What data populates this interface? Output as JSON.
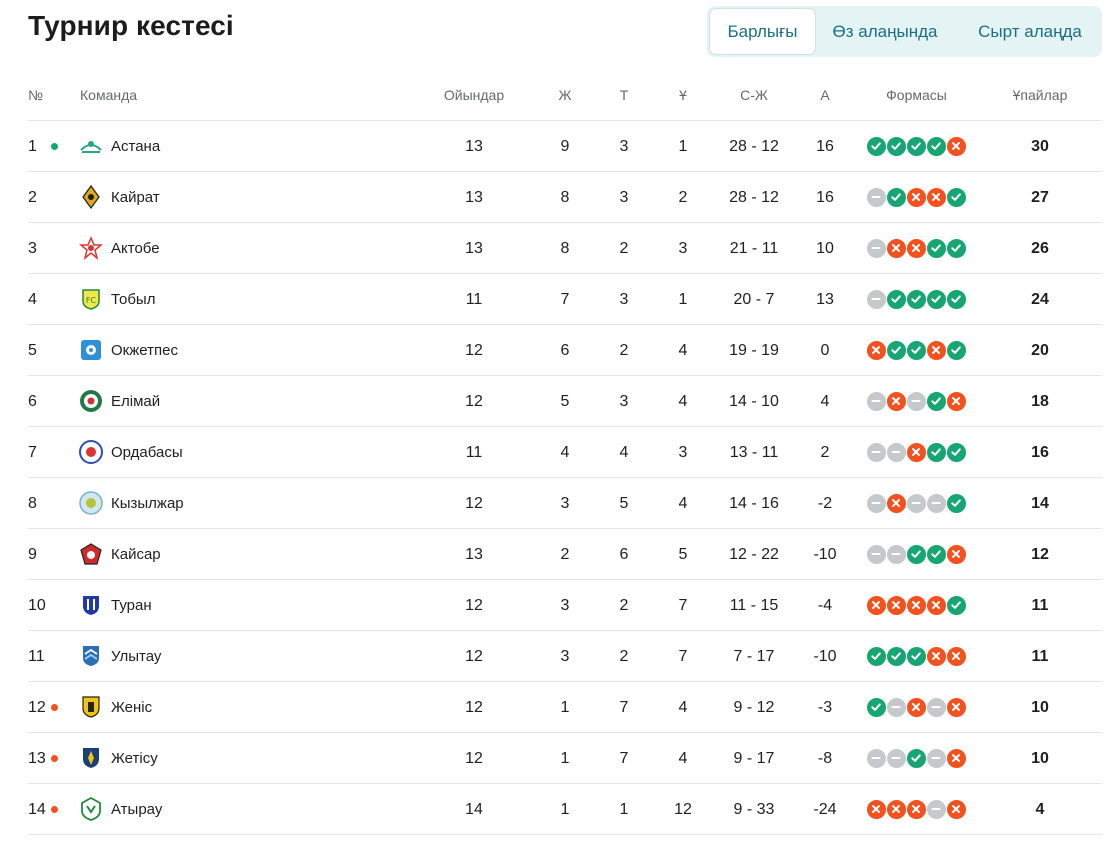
{
  "page": {
    "title": "Турнир кестесі"
  },
  "tabs": [
    {
      "label": "Барлығы",
      "active": true
    },
    {
      "label": "Өз алаңында",
      "active": false
    },
    {
      "label": "Сырт алаңда",
      "active": false
    }
  ],
  "columns": {
    "pos": "№",
    "team": "Команда",
    "games": "Ойындар",
    "w": "Ж",
    "d": "Т",
    "l": "Ұ",
    "goals": "С-Ж",
    "diff": "А",
    "form": "Формасы",
    "points": "Ұпайлар"
  },
  "colors": {
    "accent": "#1b6f83",
    "win": "#17a673",
    "loss": "#f4511e",
    "draw": "#c6c9cc",
    "qualify_dot": "#17a673",
    "relegation_dot": "#f4511e"
  },
  "rows": [
    {
      "pos": "1",
      "marker": "qualify",
      "team": "Астана",
      "logo": "astana-logo",
      "games": "13",
      "w": "9",
      "d": "3",
      "l": "1",
      "goals": "28 - 12",
      "diff": "16",
      "form": [
        "W",
        "W",
        "W",
        "W",
        "L"
      ],
      "points": "30"
    },
    {
      "pos": "2",
      "marker": "",
      "team": "Кайрат",
      "logo": "kairat-logo",
      "games": "13",
      "w": "8",
      "d": "3",
      "l": "2",
      "goals": "28 - 12",
      "diff": "16",
      "form": [
        "D",
        "W",
        "L",
        "L",
        "W"
      ],
      "points": "27"
    },
    {
      "pos": "3",
      "marker": "",
      "team": "Актобе",
      "logo": "aktobe-logo",
      "games": "13",
      "w": "8",
      "d": "2",
      "l": "3",
      "goals": "21 - 11",
      "diff": "10",
      "form": [
        "D",
        "L",
        "L",
        "W",
        "W"
      ],
      "points": "26"
    },
    {
      "pos": "4",
      "marker": "",
      "team": "Тобыл",
      "logo": "tobol-logo",
      "games": "11",
      "w": "7",
      "d": "3",
      "l": "1",
      "goals": "20 - 7",
      "diff": "13",
      "form": [
        "D",
        "W",
        "W",
        "W",
        "W"
      ],
      "points": "24"
    },
    {
      "pos": "5",
      "marker": "",
      "team": "Окжетпес",
      "logo": "okzhetpes-logo",
      "games": "12",
      "w": "6",
      "d": "2",
      "l": "4",
      "goals": "19 - 19",
      "diff": "0",
      "form": [
        "L",
        "W",
        "W",
        "L",
        "W"
      ],
      "points": "20"
    },
    {
      "pos": "6",
      "marker": "",
      "team": "Елімай",
      "logo": "elimai-logo",
      "games": "12",
      "w": "5",
      "d": "3",
      "l": "4",
      "goals": "14 - 10",
      "diff": "4",
      "form": [
        "D",
        "L",
        "D",
        "W",
        "L"
      ],
      "points": "18"
    },
    {
      "pos": "7",
      "marker": "",
      "team": "Ордабасы",
      "logo": "ordabasy-logo",
      "games": "11",
      "w": "4",
      "d": "4",
      "l": "3",
      "goals": "13 - 11",
      "diff": "2",
      "form": [
        "D",
        "D",
        "L",
        "W",
        "W"
      ],
      "points": "16"
    },
    {
      "pos": "8",
      "marker": "",
      "team": "Кызылжар",
      "logo": "kyzylzhar-logo",
      "games": "12",
      "w": "3",
      "d": "5",
      "l": "4",
      "goals": "14 - 16",
      "diff": "-2",
      "form": [
        "D",
        "L",
        "D",
        "D",
        "W"
      ],
      "points": "14"
    },
    {
      "pos": "9",
      "marker": "",
      "team": "Кайсар",
      "logo": "kaisar-logo",
      "games": "13",
      "w": "2",
      "d": "6",
      "l": "5",
      "goals": "12 - 22",
      "diff": "-10",
      "form": [
        "D",
        "D",
        "W",
        "W",
        "L"
      ],
      "points": "12"
    },
    {
      "pos": "10",
      "marker": "",
      "team": "Туран",
      "logo": "turan-logo",
      "games": "12",
      "w": "3",
      "d": "2",
      "l": "7",
      "goals": "11 - 15",
      "diff": "-4",
      "form": [
        "L",
        "L",
        "L",
        "L",
        "W"
      ],
      "points": "11"
    },
    {
      "pos": "11",
      "marker": "",
      "team": "Улытау",
      "logo": "ulytau-logo",
      "games": "12",
      "w": "3",
      "d": "2",
      "l": "7",
      "goals": "7 - 17",
      "diff": "-10",
      "form": [
        "W",
        "W",
        "W",
        "L",
        "L"
      ],
      "points": "11"
    },
    {
      "pos": "12",
      "marker": "relegation",
      "team": "Женіс",
      "logo": "zhenis-logo",
      "games": "12",
      "w": "1",
      "d": "7",
      "l": "4",
      "goals": "9 - 12",
      "diff": "-3",
      "form": [
        "W",
        "D",
        "L",
        "D",
        "L"
      ],
      "points": "10"
    },
    {
      "pos": "13",
      "marker": "relegation",
      "team": "Жетісу",
      "logo": "zhetysu-logo",
      "games": "12",
      "w": "1",
      "d": "7",
      "l": "4",
      "goals": "9 - 17",
      "diff": "-8",
      "form": [
        "D",
        "D",
        "W",
        "D",
        "L"
      ],
      "points": "10"
    },
    {
      "pos": "14",
      "marker": "relegation",
      "team": "Атырау",
      "logo": "atyrau-logo",
      "games": "14",
      "w": "1",
      "d": "1",
      "l": "12",
      "goals": "9 - 33",
      "diff": "-24",
      "form": [
        "L",
        "L",
        "L",
        "D",
        "L"
      ],
      "points": "4"
    }
  ]
}
